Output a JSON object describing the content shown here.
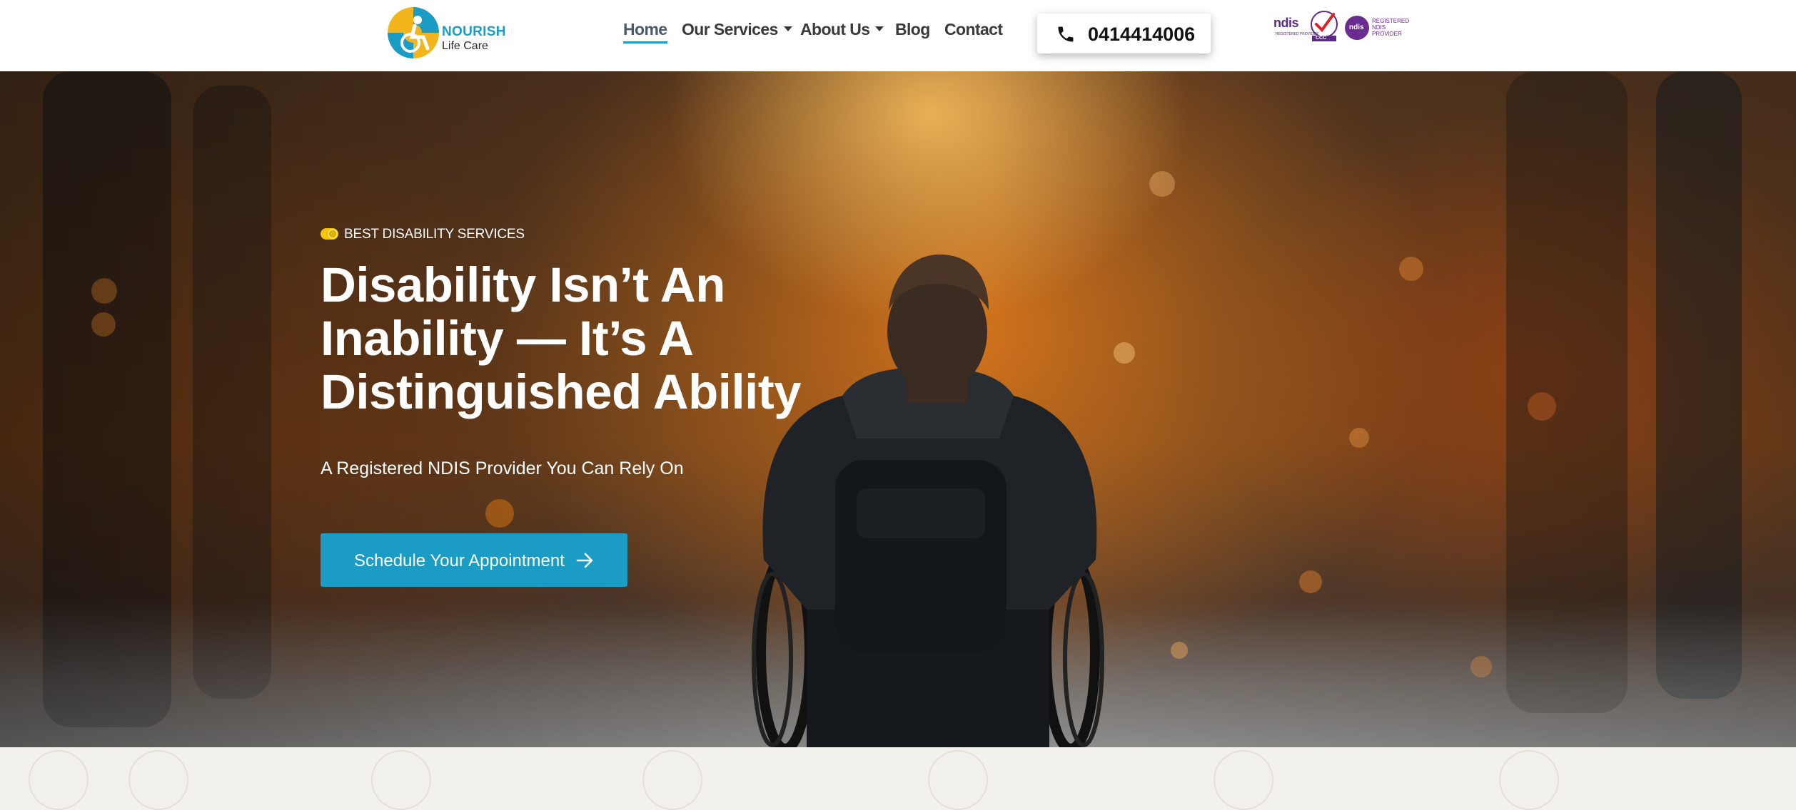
{
  "header": {
    "logo": {
      "name": "NOURISH",
      "sub": "Life Care"
    },
    "nav": [
      {
        "label": "Home",
        "active": true,
        "dropdown": false
      },
      {
        "label": "Our Services",
        "active": false,
        "dropdown": true
      },
      {
        "label": "About Us",
        "active": false,
        "dropdown": true
      },
      {
        "label": "Blog",
        "active": false,
        "dropdown": false
      },
      {
        "label": "Contact",
        "active": false,
        "dropdown": false
      }
    ],
    "phone": {
      "number": "0414414006",
      "icon": "phone-icon"
    },
    "badges": {
      "ndis": "ndis",
      "ndis_sub": "REGISTERED PROVIDER",
      "ccc": "CCC",
      "reg_ndis": "ndis",
      "reg_text": "REGISTERED NDIS PROVIDER"
    }
  },
  "hero": {
    "eyebrow": "BEST DISABILITY SERVICES",
    "headline_lines": [
      "Disability Isn’t An",
      "Inability — It’s A",
      "Distinguished Ability"
    ],
    "subline": "A Registered NDIS Provider You Can Rely On",
    "cta": {
      "label": "Schedule Your Appointment",
      "icon": "arrow-right-icon"
    }
  },
  "colors": {
    "accent": "#1a9cc4",
    "eyebrow_dot": "#f5c400",
    "badge_purple": "#6b2c91"
  }
}
